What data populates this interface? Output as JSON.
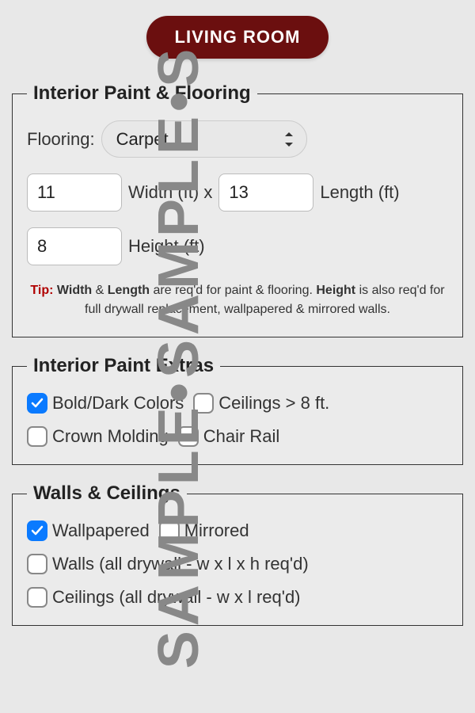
{
  "watermark": "SAMPLE•SAMPLE•S",
  "room": {
    "name": "LIVING ROOM"
  },
  "sections": {
    "paintFlooring": {
      "legend": "Interior Paint & Flooring",
      "flooringLabel": "Flooring:",
      "flooringValue": "Carpet",
      "widthValue": "11",
      "widthLabel": "Width (ft) x",
      "lengthValue": "13",
      "lengthLabel": "Length (ft)",
      "heightValue": "8",
      "heightLabel": "Height (ft)",
      "tip": {
        "label": "Tip:",
        "part1a": "Width",
        "part1b": " & ",
        "part1c": "Length",
        "part1d": " are req'd for paint & flooring. ",
        "part2a": "Height",
        "part2b": " is also req'd for full drywall replacement, wallpapered & mirrored walls."
      }
    },
    "paintExtras": {
      "legend": "Interior Paint Extras",
      "options": {
        "boldDark": {
          "label": "Bold/Dark Colors",
          "checked": true
        },
        "highCeilings": {
          "label": "Ceilings > 8 ft.",
          "checked": false
        },
        "crownMolding": {
          "label": "Crown Molding",
          "checked": false
        },
        "chairRail": {
          "label": "Chair Rail",
          "checked": false
        }
      }
    },
    "wallsCeilings": {
      "legend": "Walls & Ceilings",
      "options": {
        "wallpapered": {
          "label": "Wallpapered",
          "checked": true
        },
        "mirrored": {
          "label": "Mirrored",
          "checked": false
        },
        "wallsDrywall": {
          "label": "Walls (all drywall - w x l x h req'd)",
          "checked": false
        },
        "ceilingsDrywall": {
          "label": "Ceilings (all drywall - w x l req'd)",
          "checked": false
        }
      }
    }
  }
}
